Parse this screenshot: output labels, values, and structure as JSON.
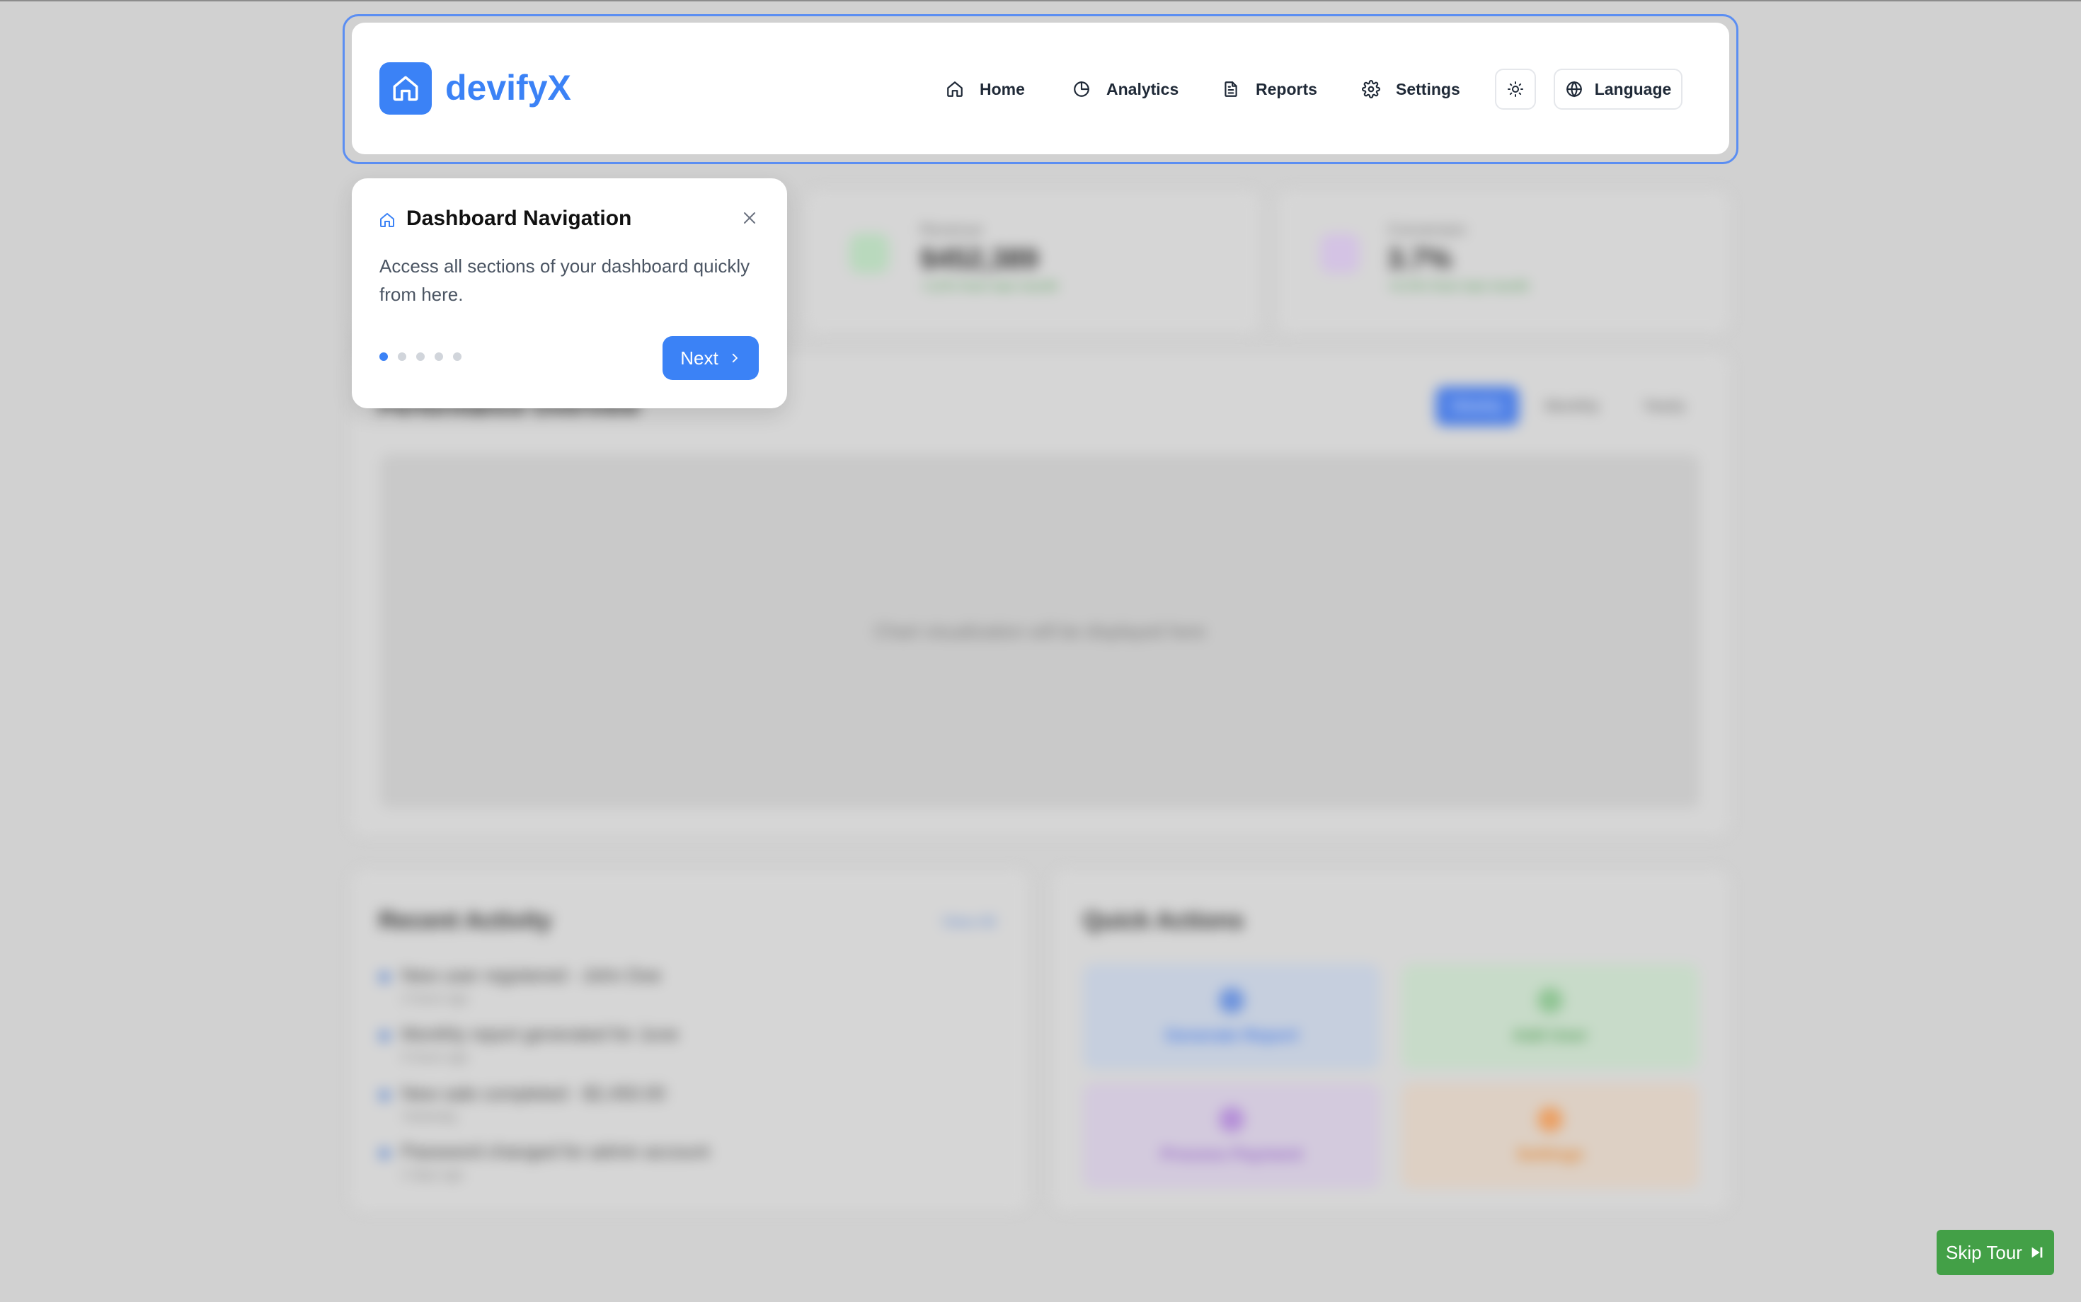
{
  "brand": {
    "name": "devifyX",
    "logo_icon": "home-icon"
  },
  "nav": {
    "items": [
      {
        "label": "Home",
        "icon": "home-icon"
      },
      {
        "label": "Analytics",
        "icon": "pie-chart-icon"
      },
      {
        "label": "Reports",
        "icon": "document-icon"
      },
      {
        "label": "Settings",
        "icon": "gear-icon"
      }
    ],
    "theme_toggle_icon": "sun-icon",
    "language_label": "Language",
    "language_icon": "globe-icon"
  },
  "tour": {
    "title": "Dashboard Navigation",
    "title_icon": "home-icon",
    "body": "Access all sections of your dashboard quickly from here.",
    "next_label": "Next",
    "step_current": 1,
    "step_total": 5,
    "skip_label": "Skip Tour",
    "skip_icon": "skip-forward-icon"
  },
  "background": {
    "stats": [
      {
        "label": "Revenue",
        "value": "$452,389",
        "change": "+12% from last month"
      },
      {
        "label": "Conversion",
        "value": "3.7%",
        "change": "+0.5% from last month"
      }
    ],
    "chart_section": {
      "title": "Performance Overview",
      "tabs": [
        "Weekly",
        "Monthly",
        "Yearly"
      ],
      "placeholder": "Chart visualization will be displayed here"
    },
    "activity": {
      "title": "Recent Activity",
      "view_all": "View All",
      "items": [
        {
          "text": "New user registered - John Doe",
          "time": "2 hours ago"
        },
        {
          "text": "Monthly report generated for June",
          "time": "5 hours ago"
        },
        {
          "text": "New sale completed - $2,450.00",
          "time": "Yesterday"
        },
        {
          "text": "Password changed for admin account",
          "time": "2 days ago"
        }
      ]
    },
    "quick_actions": {
      "title": "Quick Actions",
      "items": [
        "Generate Report",
        "Add User",
        "Process Payment",
        "Settings"
      ]
    }
  },
  "colors": {
    "accent": "#3b82f6",
    "skip_button": "#43a047",
    "overlay": "#d1d1d1"
  }
}
